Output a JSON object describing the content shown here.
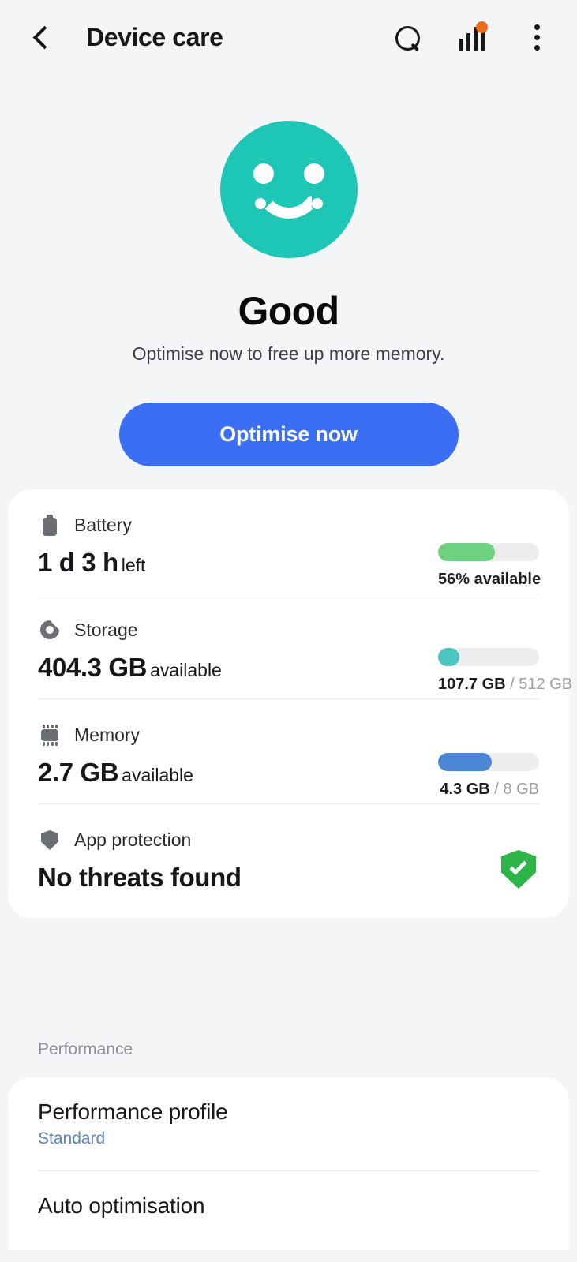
{
  "appbar": {
    "title": "Device care",
    "back_icon": "back-chevron-icon",
    "search_icon": "search-icon",
    "stats_icon": "bar-chart-icon",
    "more_icon": "overflow-menu-icon",
    "badge_color": "#ef6c1a"
  },
  "hero": {
    "face_icon": "smiley-face-icon",
    "face_color": "#1ec6b6",
    "status": "Good",
    "subtitle": "Optimise now to free up more memory.",
    "button_label": "Optimise now",
    "button_color": "#3b6ef5"
  },
  "status_rows": [
    {
      "icon": "battery-icon",
      "label": "Battery",
      "value": "1 d 3 h",
      "unit": "left",
      "meter_percent": 56,
      "meter_color": "#6ed081",
      "caption_primary": "56% available",
      "caption_secondary": ""
    },
    {
      "icon": "storage-pie-icon",
      "label": "Storage",
      "value": "404.3 GB",
      "unit": "available",
      "meter_percent": 21,
      "meter_color": "#4cc5c2",
      "caption_primary": "107.7 GB",
      "caption_secondary": "/ 512 GB"
    },
    {
      "icon": "memory-chip-icon",
      "label": "Memory",
      "value": "2.7 GB",
      "unit": "available",
      "meter_percent": 53,
      "meter_color": "#4a86d4",
      "caption_primary": "4.3 GB",
      "caption_secondary": "/ 8 GB"
    },
    {
      "icon": "shield-icon",
      "label": "App protection",
      "value": "No threats found",
      "unit": "",
      "status_icon": "shield-check-icon",
      "status_icon_color": "#2eb54a"
    }
  ],
  "performance": {
    "section_label": "Performance",
    "items": [
      {
        "title": "Performance profile",
        "subtitle": "Standard",
        "subtitle_color": "#5a82bd"
      },
      {
        "title": "Auto optimisation",
        "subtitle": ""
      }
    ]
  }
}
